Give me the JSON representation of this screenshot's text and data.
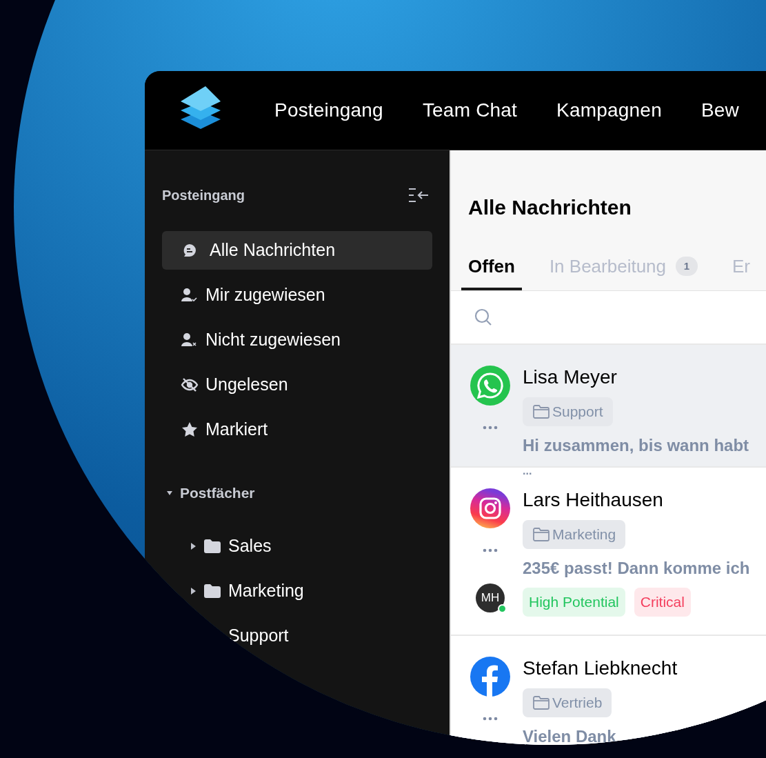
{
  "nav": [
    {
      "label": "Posteingang"
    },
    {
      "label": "Team Chat"
    },
    {
      "label": "Kampagnen"
    },
    {
      "label": "Bew"
    }
  ],
  "sidebar": {
    "title": "Posteingang",
    "items": [
      {
        "label": "Alle Nachrichten",
        "kind": "chat",
        "selected": true
      },
      {
        "label": "Mir zugewiesen",
        "kind": "assigned",
        "selected": false
      },
      {
        "label": "Nicht zugewiesen",
        "kind": "unassigned",
        "selected": false
      },
      {
        "label": "Ungelesen",
        "kind": "unread",
        "selected": false
      },
      {
        "label": "Markiert",
        "kind": "starred",
        "selected": false
      }
    ],
    "section": {
      "label": "Postfächer",
      "expanded": true,
      "children": [
        {
          "label": "Sales",
          "has_children": true
        },
        {
          "label": "Marketing",
          "has_children": true
        },
        {
          "label": "Support",
          "has_children": false
        }
      ]
    }
  },
  "main": {
    "title": "Alle Nachrichten",
    "tabs": [
      {
        "label": "Offen",
        "selected": true
      },
      {
        "label": "In Bearbeitung",
        "count": "1",
        "selected": false
      },
      {
        "label": "Er",
        "selected": false
      }
    ],
    "conversations": [
      {
        "kind": "whatsapp",
        "name": "Lisa Meyer",
        "folder": "Support",
        "preview": "Hi zusammen, bis wann habt",
        "preview_overflow": "...",
        "selected": true
      },
      {
        "kind": "instagram",
        "name": "Lars Heithausen",
        "folder": "Marketing",
        "preview": "235€ passt! Dann komme ich",
        "assignee": "MH",
        "assignee_online": true,
        "selected": false,
        "tags": [
          {
            "label": "High Potential",
            "color": "#22c55e"
          },
          {
            "label": "Critical",
            "color": "#f43f5e"
          }
        ]
      },
      {
        "kind": "facebook",
        "name": "Stefan Liebknecht",
        "folder": "Vertrieb",
        "preview": "Vielen Dank",
        "selected": false
      }
    ]
  }
}
